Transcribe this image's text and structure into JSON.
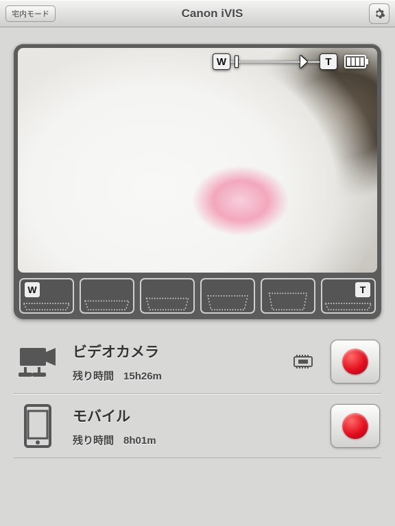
{
  "header": {
    "mode_button": "宅内モード",
    "title": "Canon iVIS",
    "settings_icon": "gear-icon"
  },
  "preview": {
    "zoom": {
      "wide_label": "W",
      "tele_label": "T",
      "position": 0.08
    },
    "battery": {
      "bars": 4
    },
    "zoom_steps": {
      "count": 6,
      "wide_label": "W",
      "tele_label": "T"
    }
  },
  "devices": [
    {
      "id": "camera",
      "title": "ビデオカメラ",
      "remaining_label": "残り時間",
      "remaining_value": "15h26m",
      "has_memory_icon": true
    },
    {
      "id": "mobile",
      "title": "モバイル",
      "remaining_label": "残り時間",
      "remaining_value": "8h01m",
      "has_memory_icon": false
    }
  ]
}
